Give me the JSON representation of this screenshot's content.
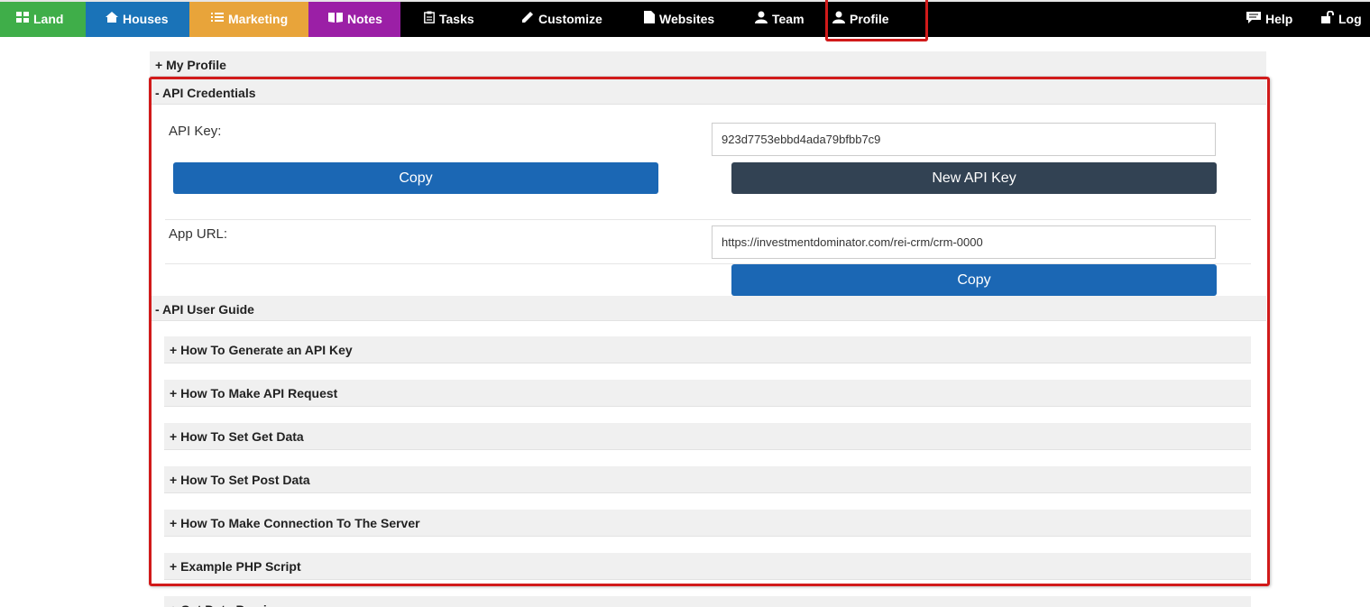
{
  "nav": {
    "items": [
      {
        "label": "Land",
        "icon": "grid-icon"
      },
      {
        "label": "Houses",
        "icon": "house-icon"
      },
      {
        "label": "Marketing",
        "icon": "list-icon"
      },
      {
        "label": "Notes",
        "icon": "book-icon"
      },
      {
        "label": "Tasks",
        "icon": "clipboard-icon"
      },
      {
        "label": "Customize",
        "icon": "pencil-icon"
      },
      {
        "label": "Websites",
        "icon": "file-icon"
      },
      {
        "label": "Team",
        "icon": "user-icon"
      },
      {
        "label": "Profile",
        "icon": "user-icon"
      }
    ],
    "help": {
      "label": "Help",
      "icon": "chat-icon"
    },
    "logout": {
      "label": "Log",
      "icon": "unlock-icon"
    }
  },
  "sections": {
    "my_profile": "+ My Profile",
    "api_credentials": "- API Credentials",
    "api_user_guide": "- API User Guide",
    "get_data_preview": "+ Get Data Preview"
  },
  "credentials": {
    "api_key_label": "API Key:",
    "api_key_value": "923d7753ebbd4ada79bfbb7c9",
    "copy_label": "Copy",
    "new_key_label": "New API Key",
    "app_url_label": "App URL:",
    "app_url_value": "https://investmentdominator.com/rei-crm/crm-0000"
  },
  "guide": {
    "items": [
      "+ How To Generate an API Key",
      "+ How To Make API Request",
      "+ How To Set Get Data",
      "+ How To Set Post Data",
      "+ How To Make Connection To The Server",
      "+ Example PHP Script"
    ]
  },
  "colors": {
    "highlight": "#d11a1a",
    "primary_button": "#1b67b4",
    "dark_button": "#324253"
  }
}
